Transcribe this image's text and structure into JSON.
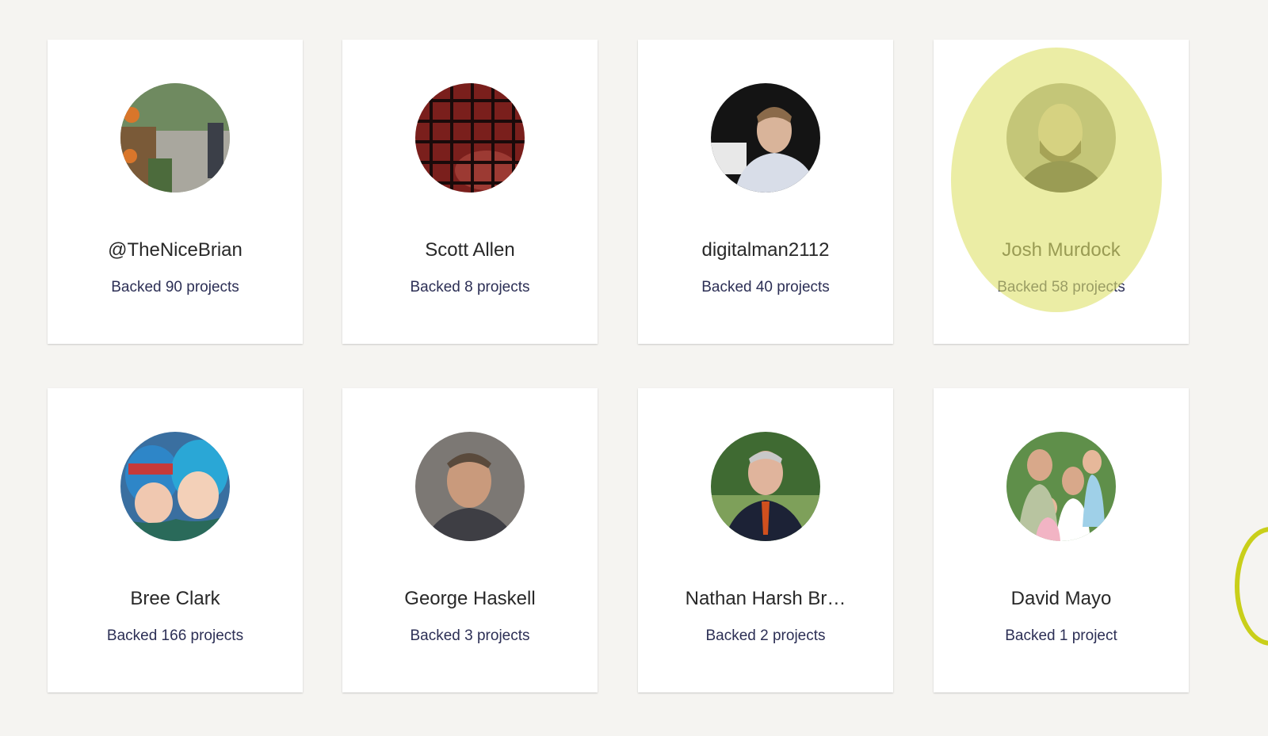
{
  "backers": [
    {
      "name": "@TheNiceBrian",
      "backed": "Backed 90 projects",
      "avatar_icon": "market-photo-icon"
    },
    {
      "name": "Scott Allen",
      "backed": "Backed 8 projects",
      "avatar_icon": "red-grid-photo-icon"
    },
    {
      "name": "digitalman2112",
      "backed": "Backed 40 projects",
      "avatar_icon": "man-in-shirt-photo-icon"
    },
    {
      "name": "Josh Murdock",
      "backed": "Backed 58 projects",
      "avatar_icon": "bearded-man-photo-icon"
    },
    {
      "name": "Bree Clark",
      "backed": "Backed 166 projects",
      "avatar_icon": "winter-hats-photo-icon"
    },
    {
      "name": "George Haskell",
      "backed": "Backed 3 projects",
      "avatar_icon": "smiling-man-photo-icon"
    },
    {
      "name": "Nathan Harsh Br…",
      "backed": "Backed 2 projects",
      "avatar_icon": "man-in-suit-photo-icon"
    },
    {
      "name": "David Mayo",
      "backed": "Backed 1 project",
      "avatar_icon": "family-photo-icon"
    }
  ],
  "colors": {
    "page_background": "#f5f4f1",
    "card_background": "#ffffff",
    "name_text": "#282828",
    "backed_text": "#2c2f55",
    "highlight": "#dee26e",
    "cursor_ring": "#c9cf1a"
  }
}
